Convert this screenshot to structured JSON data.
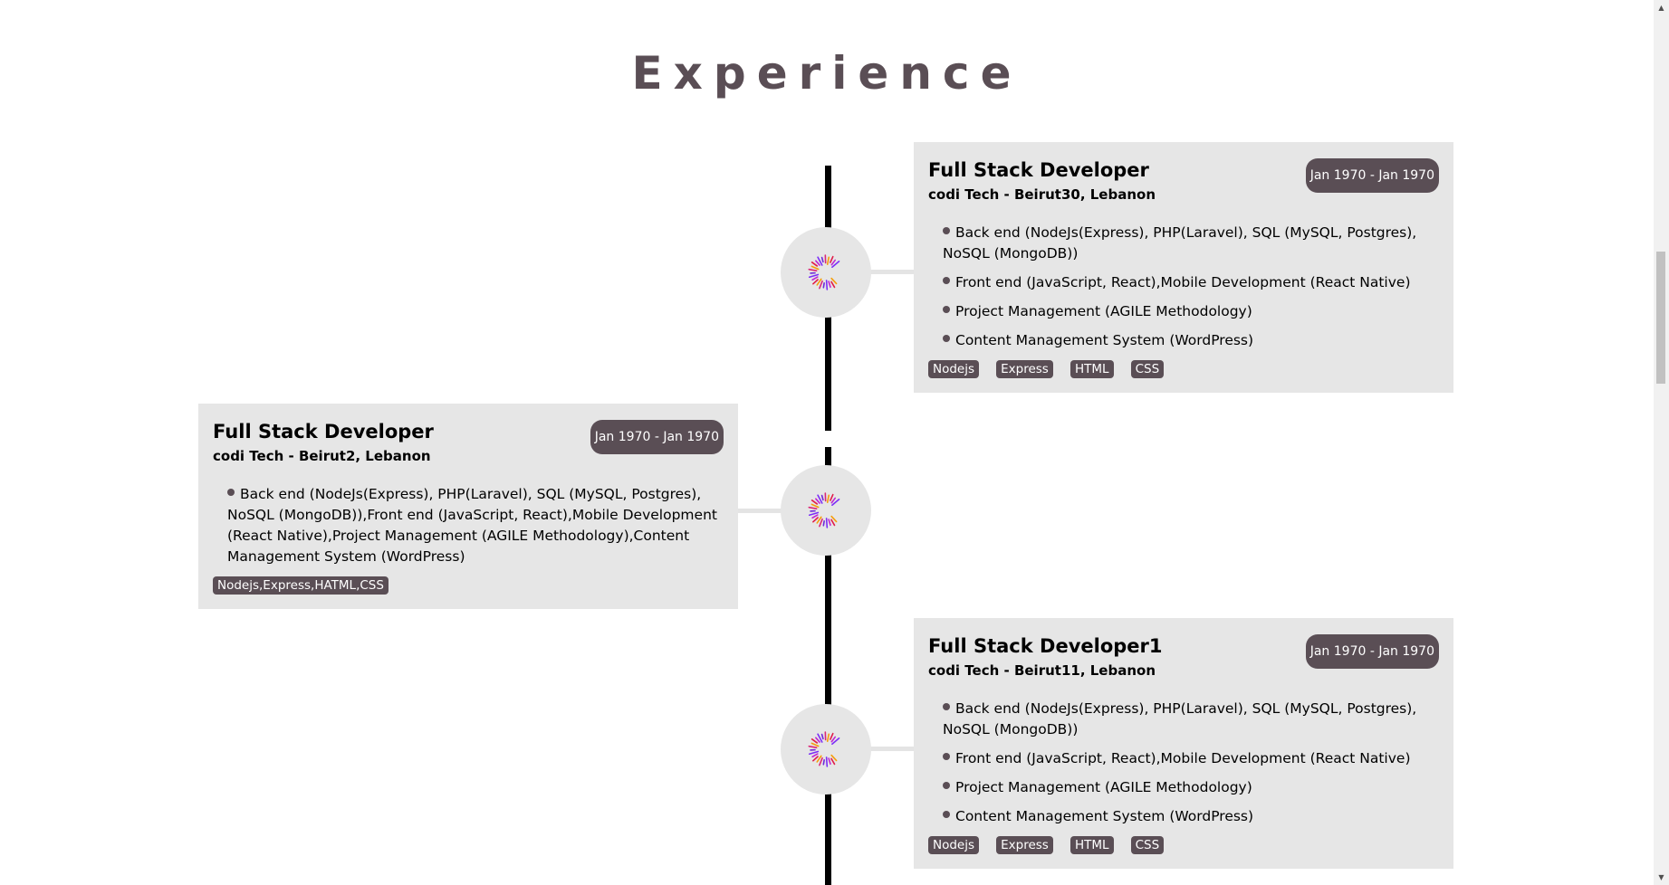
{
  "section": {
    "title": "Experience"
  },
  "experiences": [
    {
      "title": "Full Stack Developer",
      "company": "codi Tech - Beirut30, Lebanon",
      "date": "Jan 1970 - Jan 1970",
      "responsibilities": [
        "Back end (NodeJs(Express), PHP(Laravel), SQL (MySQL, Postgres), NoSQL (MongoDB))",
        "Front end (JavaScript, React),Mobile Development (React Native)",
        "Project Management (AGILE Methodology)",
        "Content Management System (WordPress)"
      ],
      "tags": [
        "Nodejs",
        "Express",
        "HTML",
        "CSS"
      ]
    },
    {
      "title": "Full Stack Developer",
      "company": "codi Tech - Beirut2, Lebanon",
      "date": "Jan 1970 - Jan 1970",
      "responsibilities": [
        "Back end (NodeJs(Express), PHP(Laravel), SQL (MySQL, Postgres), NoSQL (MongoDB)),Front end (JavaScript, React),Mobile Development (React Native),Project Management (AGILE Methodology),Content Management System (WordPress)"
      ],
      "tags": [
        "Nodejs,Express,HATML,CSS"
      ]
    },
    {
      "title": "Full Stack Developer1",
      "company": "codi Tech - Beirut11, Lebanon",
      "date": "Jan 1970 - Jan 1970",
      "responsibilities": [
        "Back end (NodeJs(Express), PHP(Laravel), SQL (MySQL, Postgres), NoSQL (MongoDB))",
        "Front end (JavaScript, React),Mobile Development (React Native)",
        "Project Management (AGILE Methodology)",
        "Content Management System (WordPress)"
      ],
      "tags": [
        "Nodejs",
        "Express",
        "HTML",
        "CSS"
      ]
    }
  ],
  "icons": {
    "company_logo": "codi-logo-icon",
    "scroll_up": "arrow-up-icon",
    "scroll_down": "arrow-down-icon"
  },
  "colors": {
    "accent": "#5a4e55",
    "card_bg": "#e6e6e6",
    "timeline": "#000000"
  }
}
